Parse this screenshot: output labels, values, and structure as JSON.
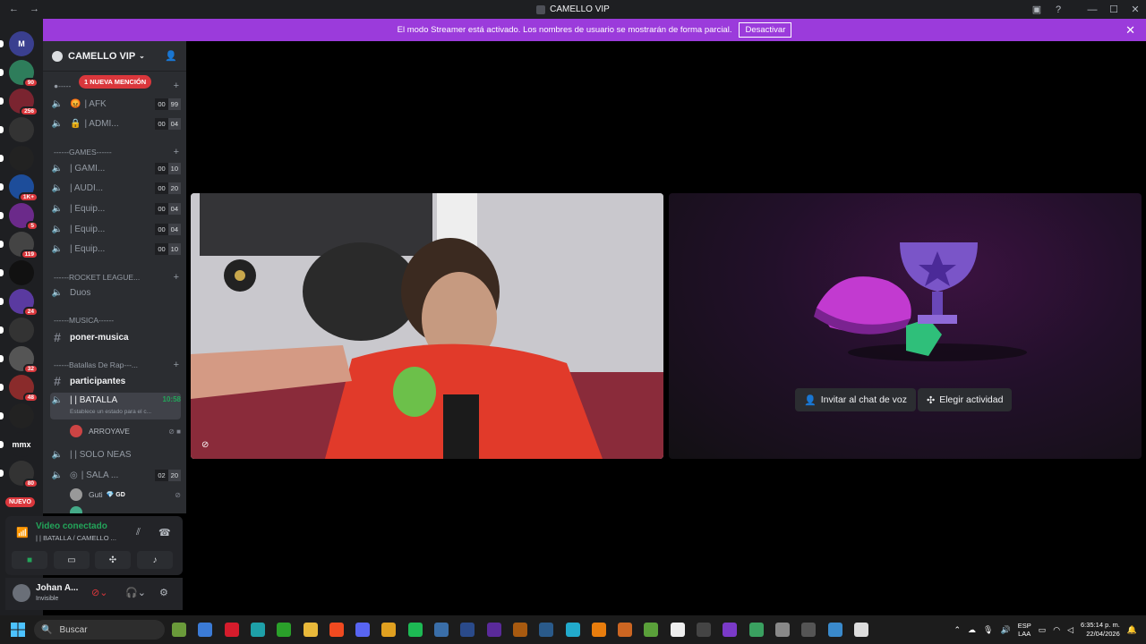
{
  "window": {
    "title": "CAMELLO VIP"
  },
  "banner": {
    "text": "El modo Streamer está activado. Los nombres de usuario se mostrarán de forma parcial.",
    "button": "Desactivar"
  },
  "rail": {
    "servers": [
      {
        "label": "M",
        "badge": ""
      },
      {
        "label": "",
        "badge": "90"
      },
      {
        "label": "",
        "badge": "256"
      },
      {
        "label": "",
        "badge": ""
      },
      {
        "label": "",
        "badge": ""
      },
      {
        "label": "",
        "badge": "1K+"
      },
      {
        "label": "",
        "badge": "5"
      },
      {
        "label": "",
        "badge": "119"
      },
      {
        "label": "",
        "badge": ""
      },
      {
        "label": "",
        "badge": "24"
      },
      {
        "label": "",
        "badge": ""
      },
      {
        "label": "",
        "badge": "32"
      },
      {
        "label": "",
        "badge": "48"
      },
      {
        "label": "",
        "badge": ""
      },
      {
        "label": "mmx",
        "badge": ""
      },
      {
        "label": "",
        "badge": "80"
      }
    ],
    "new_label": "NUEVO"
  },
  "guild": {
    "name": "CAMELLO VIP"
  },
  "mention": "1 NUEVA MENCIÓN",
  "categories": {
    "games": "------GAMES------",
    "rocket": "------ROCKET LEAGUE...",
    "musica": "------MUSICA------",
    "batallas": "------Batallas De Rap---..."
  },
  "channels": {
    "afk": {
      "name": "| AFK",
      "a": "00",
      "b": "99"
    },
    "admin": {
      "name": "| ADMI...",
      "a": "00",
      "b": "04"
    },
    "gami": {
      "name": "| GAMI...",
      "a": "00",
      "b": "10"
    },
    "audi": {
      "name": "| AUDI...",
      "a": "00",
      "b": "20"
    },
    "equip1": {
      "name": "| Equip...",
      "a": "00",
      "b": "04"
    },
    "equip2": {
      "name": "| Equip...",
      "a": "00",
      "b": "04"
    },
    "equip3": {
      "name": "| Equip...",
      "a": "00",
      "b": "10"
    },
    "duos": {
      "name": "Duos"
    },
    "poner": {
      "name": "poner-musica"
    },
    "participantes": {
      "name": "participantes"
    },
    "batalla": {
      "name": "| | BATALLA",
      "time": "10:58",
      "sub": "Establece un estado para el c..."
    },
    "neas": {
      "name": "| | SOLO NEAS"
    },
    "sala": {
      "name": "| SALA ...",
      "a": "02",
      "b": "20"
    }
  },
  "voice_users": {
    "arroyave": "ARROYAVE",
    "guti": "Guti",
    "guti_tag": "GD"
  },
  "voice_panel": {
    "title": "Video conectado",
    "sub": "| | BATALLA / CAMELLO ..."
  },
  "user": {
    "name": "Johan A...",
    "status": "Invisible"
  },
  "activity": {
    "invite": "Invitar al chat de voz",
    "choose": "Elegir actividad"
  },
  "taskbar": {
    "search": "Buscar",
    "lang1": "ESP",
    "lang2": "LAA",
    "time": "6:35:14 p. m.",
    "date": "22/04/2026"
  }
}
